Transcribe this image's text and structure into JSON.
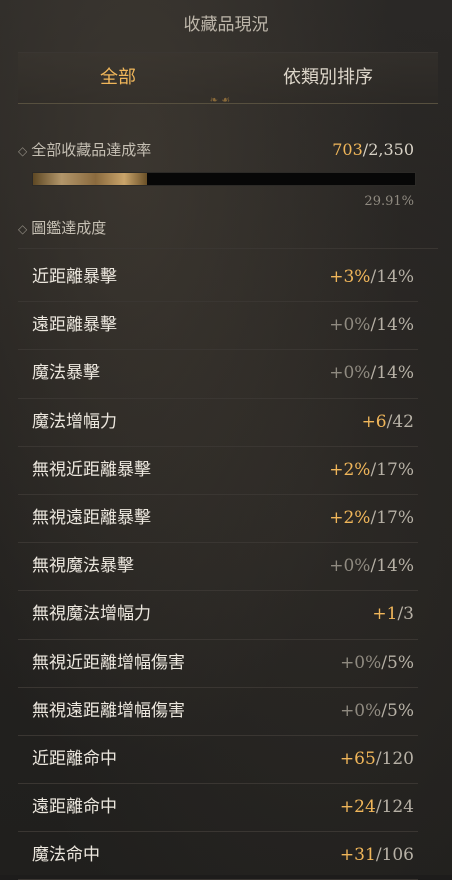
{
  "title": "收藏品現況",
  "tabs": [
    {
      "label": "全部",
      "active": true
    },
    {
      "label": "依類別排序",
      "active": false
    }
  ],
  "summary": {
    "label": "全部收藏品達成率",
    "current": "703",
    "total": "2,350",
    "progress_fraction": 0.2991,
    "percent": "29.91%",
    "sub_label": "圖鑑達成度"
  },
  "stats": [
    {
      "label": "近距離暴擊",
      "bonus": "+3%",
      "max": "14%"
    },
    {
      "label": "遠距離暴擊",
      "bonus": "+0%",
      "max": "14%"
    },
    {
      "label": "魔法暴擊",
      "bonus": "+0%",
      "max": "14%"
    },
    {
      "label": "魔法增幅力",
      "bonus": "+6",
      "max": "42"
    },
    {
      "label": "無視近距離暴擊",
      "bonus": "+2%",
      "max": "17%"
    },
    {
      "label": "無視遠距離暴擊",
      "bonus": "+2%",
      "max": "17%"
    },
    {
      "label": "無視魔法暴擊",
      "bonus": "+0%",
      "max": "14%"
    },
    {
      "label": "無視魔法增幅力",
      "bonus": "+1",
      "max": "3"
    },
    {
      "label": "無視近距離增幅傷害",
      "bonus": "+0%",
      "max": "5%"
    },
    {
      "label": "無視遠距離增幅傷害",
      "bonus": "+0%",
      "max": "5%"
    },
    {
      "label": "近距離命中",
      "bonus": "+65",
      "max": "120"
    },
    {
      "label": "遠距離命中",
      "bonus": "+24",
      "max": "124"
    },
    {
      "label": "魔法命中",
      "bonus": "+31",
      "max": "106"
    }
  ],
  "colors": {
    "accent": "#f0b65a",
    "muted": "#8f8a80"
  }
}
